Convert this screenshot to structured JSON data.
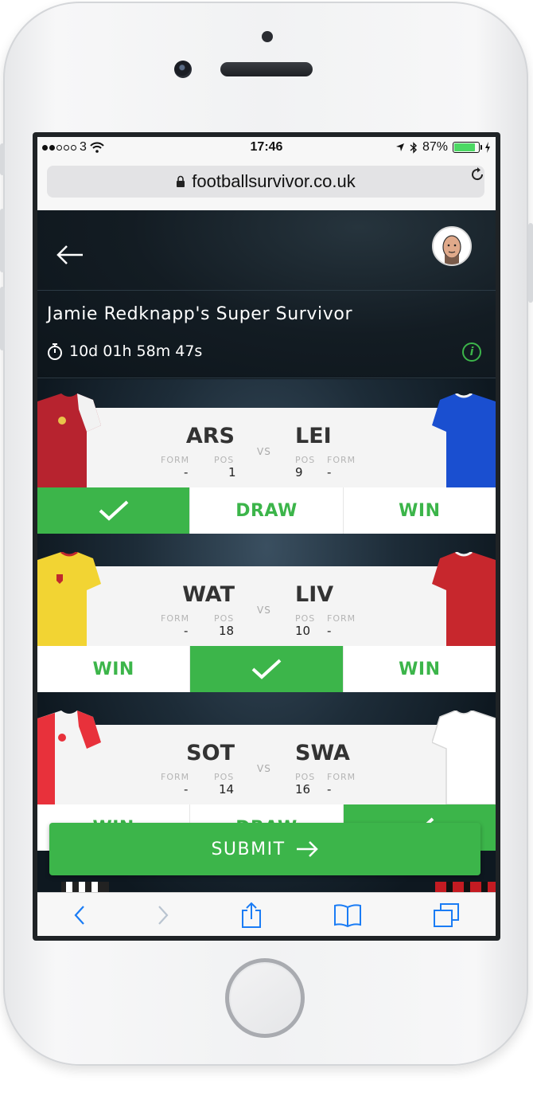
{
  "status_bar": {
    "carrier": "3",
    "time": "17:46",
    "battery": "87%"
  },
  "url_bar": {
    "url": "footballsurvivor.co.uk"
  },
  "header": {
    "title": "Jamie Redknapp's Super Survivor",
    "countdown": "10d 01h 58m 47s"
  },
  "fixtures": [
    {
      "home": {
        "team": "ARS",
        "form_label": "FORM",
        "pos_label": "POS",
        "form": "-",
        "pos": "1"
      },
      "away": {
        "team": "LEI",
        "form_label": "FORM",
        "pos_label": "POS",
        "form": "-",
        "pos": "9"
      },
      "vs": "VS",
      "options": [
        "",
        "DRAW",
        "WIN"
      ],
      "selected": 0
    },
    {
      "home": {
        "team": "WAT",
        "form_label": "FORM",
        "pos_label": "POS",
        "form": "-",
        "pos": "18"
      },
      "away": {
        "team": "LIV",
        "form_label": "FORM",
        "pos_label": "POS",
        "form": "-",
        "pos": "10"
      },
      "vs": "VS",
      "options": [
        "WIN",
        "",
        "WIN"
      ],
      "selected": 1
    },
    {
      "home": {
        "team": "SOT",
        "form_label": "FORM",
        "pos_label": "POS",
        "form": "-",
        "pos": "14"
      },
      "away": {
        "team": "SWA",
        "form_label": "FORM",
        "pos_label": "POS",
        "form": "-",
        "pos": "16"
      },
      "vs": "VS",
      "options": [
        "WIN",
        "DRAW",
        ""
      ],
      "selected": 2
    }
  ],
  "submit": {
    "label": "SUBMIT"
  },
  "colors": {
    "accent": "#3cb54a",
    "header_bg": "#131c23",
    "arsenal": "#b7232f",
    "leicester": "#1a4fd0",
    "watford": "#f2d433",
    "liverpool": "#c7272d",
    "southampton": "#e8313b",
    "swansea": "#ffffff"
  },
  "icons": [
    "back-arrow-icon",
    "avatar",
    "stopwatch-icon",
    "info-icon",
    "checkmark-icon",
    "arrow-right-icon",
    "lock-icon",
    "reload-icon",
    "back-chevron-icon",
    "forward-chevron-icon",
    "share-icon",
    "bookmarks-icon",
    "tabs-icon"
  ]
}
